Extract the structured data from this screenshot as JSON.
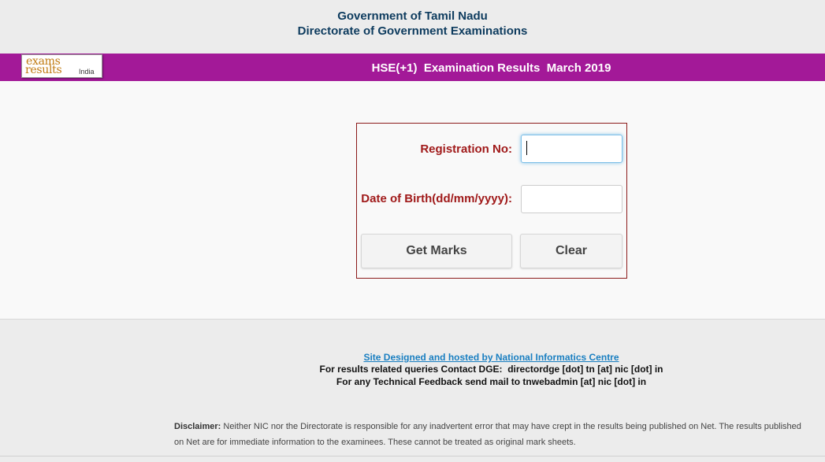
{
  "header": {
    "line1": "Government of Tamil Nadu",
    "line2": "Directorate of Government Examinations"
  },
  "banner": {
    "logo": {
      "word1": "exams",
      "word2": "results",
      "word3": "India"
    },
    "title": "HSE(+1)  Examination Results  March 2019",
    "color": "#a31998"
  },
  "form": {
    "registration_label": "Registration No:",
    "registration_value": "",
    "dob_label": "Date of Birth(dd/mm/yyyy):",
    "dob_value": "",
    "get_marks_label": "Get Marks",
    "clear_label": "Clear",
    "border_color": "#8b1a1a",
    "label_color": "#a01a1a"
  },
  "footer": {
    "link_text": "Site Designed and hosted by National Informatics Centre",
    "contact_line": "For results related queries Contact DGE:  directordge [dot] tn [at] nic [dot] in",
    "feedback_line": "For any Technical Feedback send mail to tnwebadmin [at] nic [dot] in",
    "disclaimer_label": "Disclaimer:",
    "disclaimer_text": " Neither NIC nor the Directorate is responsible for any inadvertent error that may have crept in the results being published on Net. The results published on Net are for immediate information to the examinees. These cannot be treated as original mark sheets."
  }
}
